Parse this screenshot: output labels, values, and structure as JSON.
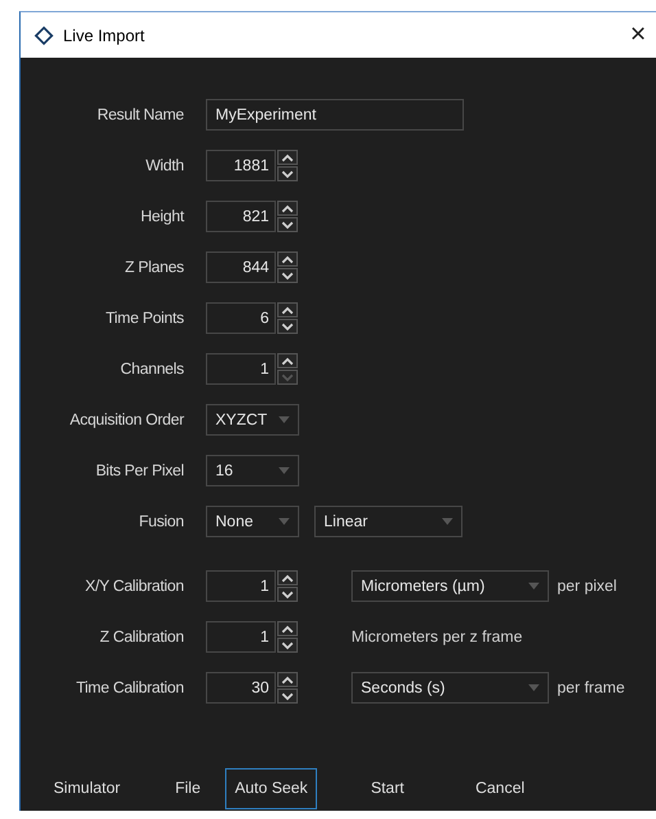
{
  "window": {
    "title": "Live Import",
    "close": "×"
  },
  "fields": [
    {
      "kind": "text",
      "label": "Result Name",
      "value": "MyExperiment"
    },
    {
      "kind": "spin",
      "label": "Width",
      "value": "1881",
      "decrement_disabled": false
    },
    {
      "kind": "spin",
      "label": "Height",
      "value": "821",
      "decrement_disabled": false
    },
    {
      "kind": "spin",
      "label": "Z Planes",
      "value": "844",
      "decrement_disabled": false
    },
    {
      "kind": "spin",
      "label": "Time Points",
      "value": "6",
      "decrement_disabled": false
    },
    {
      "kind": "spin",
      "label": "Channels",
      "value": "1",
      "decrement_disabled": true
    },
    {
      "kind": "dropdown",
      "label": "Acquisition Order",
      "value": "XYZCT"
    },
    {
      "kind": "dropdown",
      "label": "Bits Per Pixel",
      "value": "16"
    },
    {
      "kind": "dropdown_pair",
      "label": "Fusion",
      "value": "None",
      "second_value": "Linear"
    }
  ],
  "calibration": [
    {
      "kind": "spin_unit",
      "label": "X/Y Calibration",
      "value": "1",
      "decrement_disabled": false,
      "unit": "Micrometers  (µm)",
      "suffix": "per pixel"
    },
    {
      "kind": "spin_note",
      "label": "Z Calibration",
      "value": "1",
      "decrement_disabled": false,
      "note": "Micrometers per z frame"
    },
    {
      "kind": "spin_unit",
      "label": "Time Calibration",
      "value": "30",
      "decrement_disabled": false,
      "unit": "Seconds  (s)",
      "suffix": "per frame"
    }
  ],
  "buttons": [
    {
      "label": "Simulator",
      "focused": false
    },
    {
      "label": "File",
      "focused": false
    },
    {
      "label": "Auto Seek",
      "focused": true
    },
    {
      "label": "Start",
      "focused": false
    },
    {
      "label": "Cancel",
      "focused": false
    }
  ]
}
